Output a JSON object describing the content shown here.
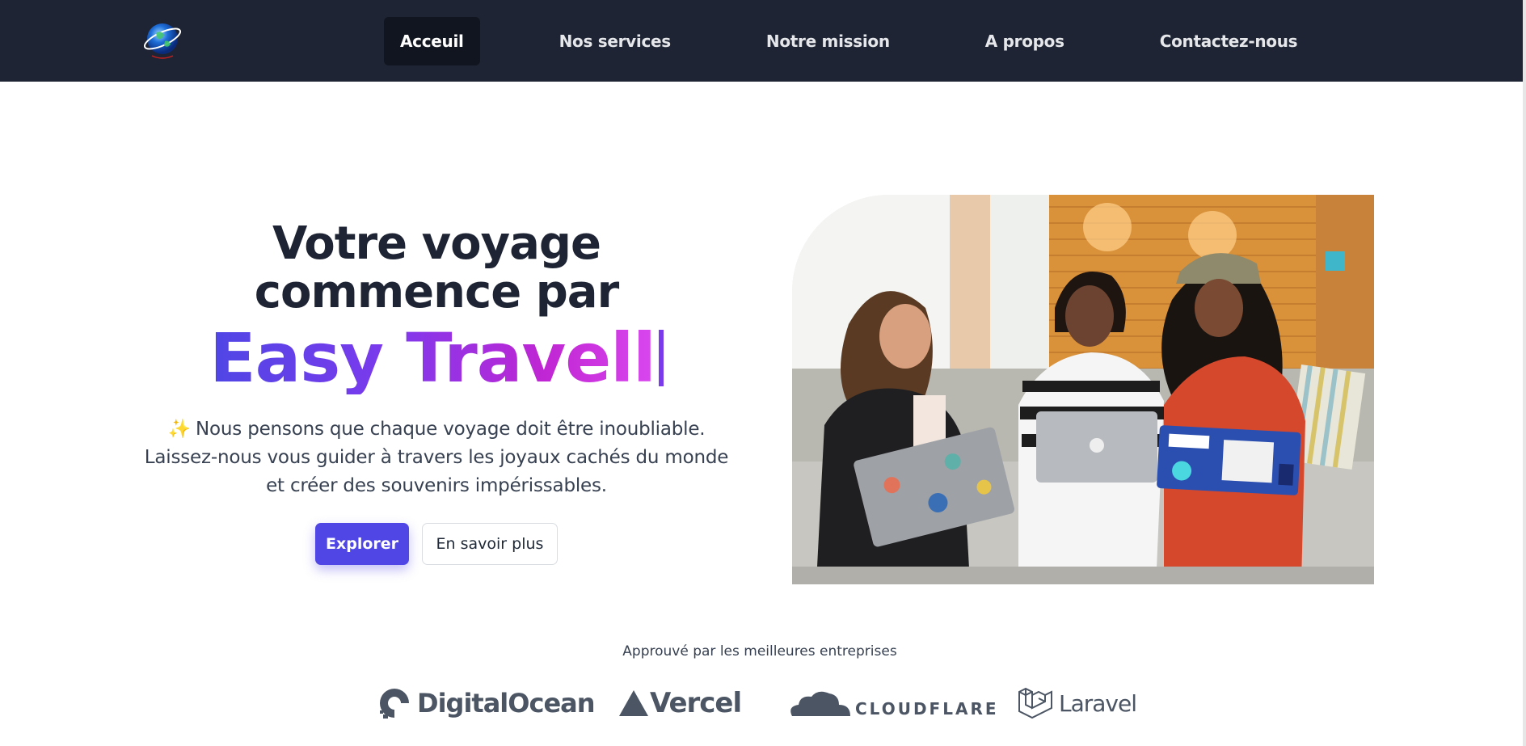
{
  "nav": {
    "items": [
      {
        "label": "Acceuil",
        "active": true
      },
      {
        "label": "Nos services",
        "active": false
      },
      {
        "label": "Notre mission",
        "active": false
      },
      {
        "label": "A propos",
        "active": false
      },
      {
        "label": "Contactez-nous",
        "active": false
      }
    ]
  },
  "hero": {
    "title_line1": "Votre voyage",
    "title_line2": "commence par",
    "brand": "Easy Travell",
    "desc_line1": "Nous pensons que chaque voyage doit être inoubliable.",
    "desc_line2": "Laissez-nous vous guider à travers les joyaux cachés du monde",
    "desc_line3": "et créer des souvenirs impérissables.",
    "spark_icon": "sparkles-icon",
    "primary_button": "Explorer",
    "secondary_button": "En savoir plus"
  },
  "trusted": {
    "label": "Approuvé par les meilleures entreprises",
    "companies": [
      "DigitalOcean",
      "Vercel",
      "CLOUDFLARE",
      "Laravel"
    ]
  },
  "colors": {
    "nav_bg": "#1e2433",
    "accent": "#4f46e5",
    "gradient_end": "#d946ef"
  }
}
